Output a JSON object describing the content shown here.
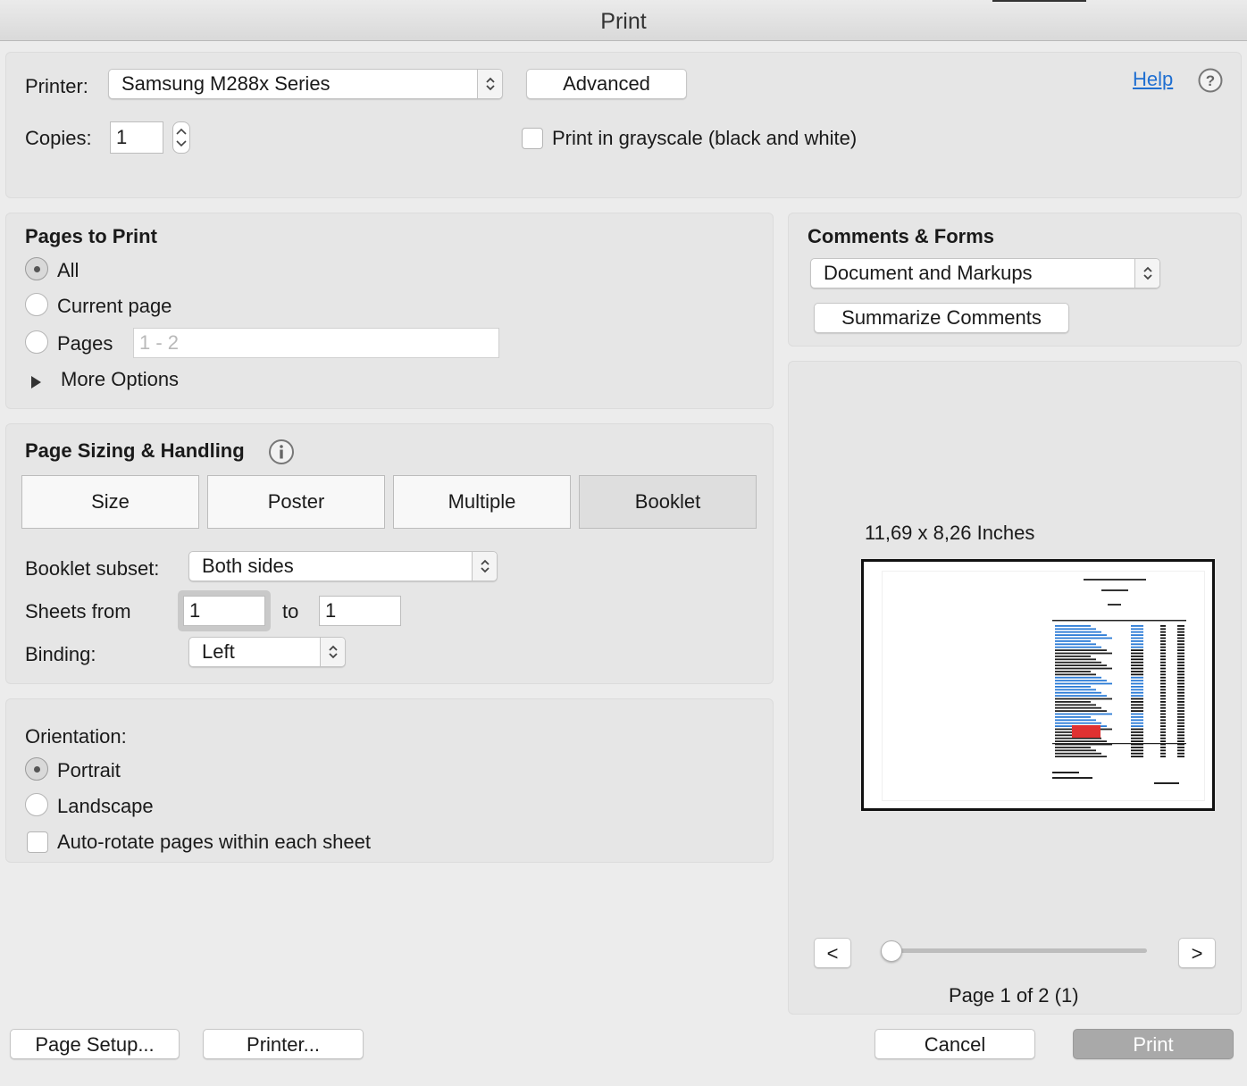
{
  "window": {
    "title": "Print"
  },
  "printer": {
    "label": "Printer:",
    "selected": "Samsung M288x Series",
    "advanced_label": "Advanced",
    "help_label": "Help",
    "copies_label": "Copies:",
    "copies_value": "1",
    "grayscale_label": "Print in grayscale (black and white)",
    "grayscale_checked": false
  },
  "pages_to_print": {
    "heading": "Pages to Print",
    "options": [
      {
        "label": "All",
        "selected": true
      },
      {
        "label": "Current page",
        "selected": false
      },
      {
        "label": "Pages",
        "selected": false
      }
    ],
    "pages_placeholder": "1 - 2",
    "more_options_label": "More Options"
  },
  "page_sizing": {
    "heading": "Page Sizing & Handling",
    "tabs": [
      {
        "label": "Size",
        "selected": false
      },
      {
        "label": "Poster",
        "selected": false
      },
      {
        "label": "Multiple",
        "selected": false
      },
      {
        "label": "Booklet",
        "selected": true
      }
    ],
    "booklet_subset_label": "Booklet subset:",
    "booklet_subset_value": "Both sides",
    "sheets_from_label": "Sheets from",
    "sheets_from_value": "1",
    "to_label": "to",
    "sheets_to_value": "1",
    "binding_label": "Binding:",
    "binding_value": "Left"
  },
  "orientation": {
    "heading": "Orientation:",
    "options": [
      {
        "label": "Portrait",
        "selected": true
      },
      {
        "label": "Landscape",
        "selected": false
      }
    ],
    "auto_rotate_label": "Auto-rotate pages within each sheet",
    "auto_rotate_checked": false
  },
  "comments_forms": {
    "heading": "Comments & Forms",
    "selected": "Document and Markups",
    "summarize_label": "Summarize Comments"
  },
  "preview": {
    "dimensions": "11,69 x 8,26 Inches",
    "prev_label": "<",
    "next_label": ">",
    "slider_fraction": 0.0,
    "page_status": "Page 1 of 2 (1)"
  },
  "footer": {
    "page_setup_label": "Page Setup...",
    "printer_label": "Printer...",
    "cancel_label": "Cancel",
    "print_label": "Print"
  },
  "colors": {
    "link": "#1f6fd1",
    "print_button": "#a9a9a9",
    "preview_highlight": "#e03131",
    "preview_text_blue": "#2b7bd6"
  }
}
